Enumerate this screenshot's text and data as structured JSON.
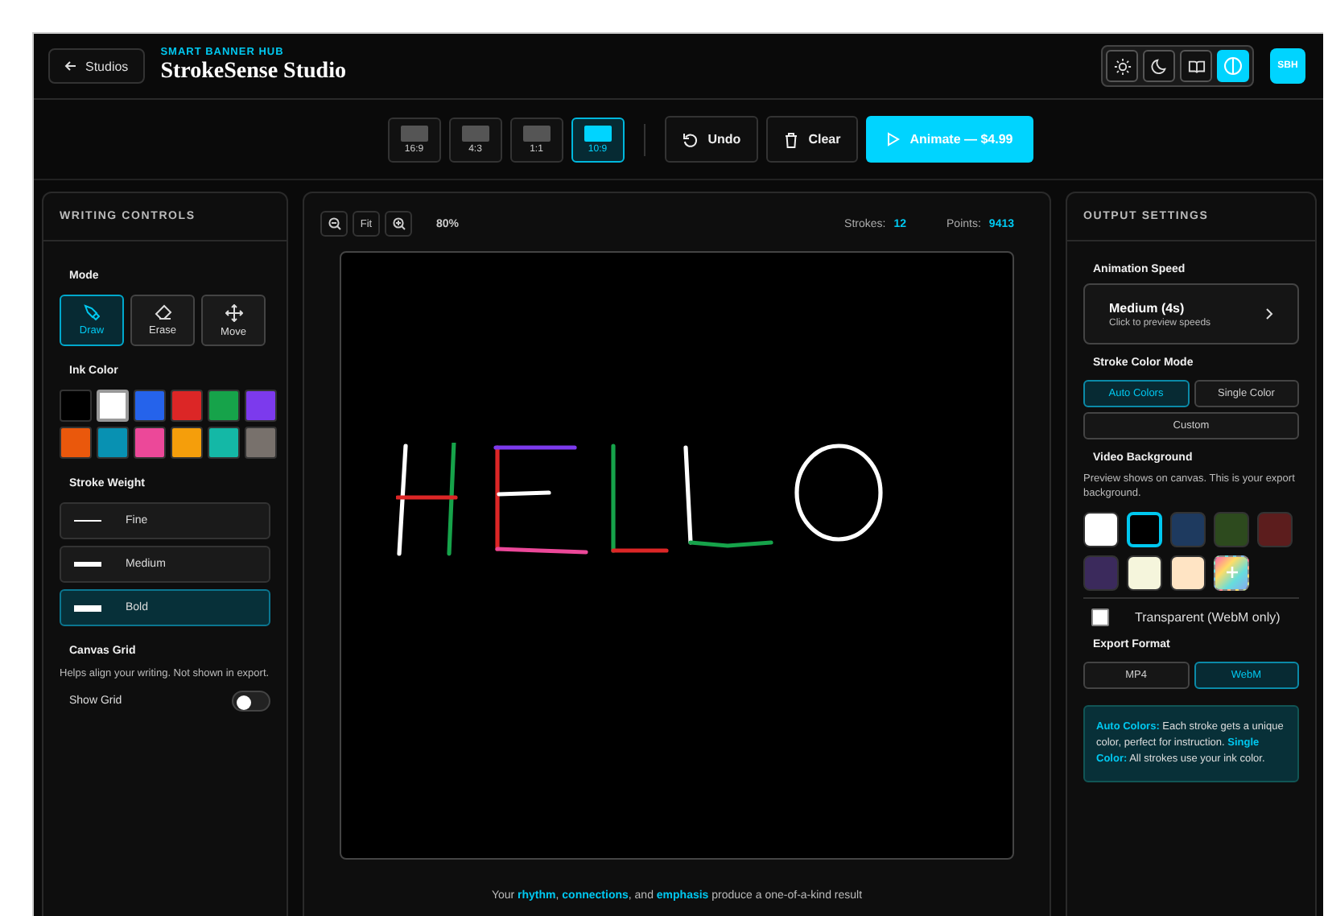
{
  "header": {
    "back_button": "Studios",
    "eyebrow": "SMART BANNER HUB",
    "title": "StrokeSense Studio",
    "theme_buttons": [
      {
        "kind": "sun",
        "selected": false
      },
      {
        "kind": "moon",
        "selected": false
      },
      {
        "kind": "book",
        "selected": false
      },
      {
        "kind": "contrast",
        "selected": true
      }
    ],
    "avatar": "SBH"
  },
  "toolbar": {
    "ratios": [
      {
        "label": "16:9",
        "selected": false
      },
      {
        "label": "4:3",
        "selected": false
      },
      {
        "label": "1:1",
        "selected": false
      },
      {
        "label": "10:9",
        "selected": true
      }
    ],
    "undo": "Undo",
    "clear": "Clear",
    "animate": "Animate — $4.99"
  },
  "writing_controls": {
    "title": "WRITING CONTROLS",
    "mode_label": "Mode",
    "modes": [
      {
        "kind": "draw",
        "label": "Draw",
        "selected": true
      },
      {
        "kind": "erase",
        "label": "Erase",
        "selected": false
      },
      {
        "kind": "move",
        "label": "Move",
        "selected": false
      }
    ],
    "ink_label": "Ink Color",
    "ink_colors": [
      {
        "color": "#000000",
        "selected": false
      },
      {
        "color": "#ffffff",
        "selected": true
      },
      {
        "color": "#2563eb",
        "selected": false
      },
      {
        "color": "#dc2626",
        "selected": false
      },
      {
        "color": "#16a34a",
        "selected": false
      },
      {
        "color": "#7c3aed",
        "selected": false
      },
      {
        "color": "#ea580c",
        "selected": false
      },
      {
        "color": "#0891b2",
        "selected": false
      },
      {
        "color": "#ec4899",
        "selected": false
      },
      {
        "color": "#f59e0b",
        "selected": false
      },
      {
        "color": "#14b8a6",
        "selected": false
      },
      {
        "color": "#78716c",
        "selected": false
      }
    ],
    "weight_label": "Stroke Weight",
    "weights": [
      {
        "kind": "fine",
        "label": "Fine",
        "selected": false
      },
      {
        "kind": "medium",
        "label": "Medium",
        "selected": false
      },
      {
        "kind": "bold",
        "label": "Bold",
        "selected": true
      }
    ],
    "grid_label": "Canvas Grid",
    "grid_hint": "Helps align your writing. Not shown in export.",
    "grid_toggle": {
      "label": "Show Grid",
      "on": false
    }
  },
  "canvas": {
    "fit": "Fit",
    "zoom": "80%",
    "strokes_label": "Strokes:",
    "strokes": "12",
    "points_label": "Points:",
    "points": "9413",
    "footer": "Your **rhythm**, **connections**, and **emphasis** produce a one-of-a-kind result"
  },
  "output_settings": {
    "title": "OUTPUT SETTINGS",
    "speed_label": "Animation Speed",
    "speed": "Medium (4s)",
    "speed_hint": "Click to preview speeds",
    "color_mode_label": "Stroke Color Mode",
    "color_modes": [
      {
        "label": "Auto Colors",
        "selected": true
      },
      {
        "label": "Single Color",
        "selected": false
      },
      {
        "label": "Custom",
        "selected": false
      }
    ],
    "background_label": "Video Background",
    "background_hint": "Preview shows on canvas. This is your export background.",
    "backgrounds": [
      {
        "kind": "solid",
        "color": "#ffffff",
        "selected": false
      },
      {
        "kind": "solid",
        "color": "#000000",
        "selected": true
      },
      {
        "kind": "solid",
        "color": "#1e3a5f",
        "selected": false
      },
      {
        "kind": "solid",
        "color": "#2d4a1e",
        "selected": false
      },
      {
        "kind": "solid",
        "color": "#5c1d1d",
        "selected": false
      },
      {
        "kind": "solid",
        "color": "#3b2a5c",
        "selected": false
      },
      {
        "kind": "solid",
        "color": "#f5f5dc",
        "selected": false
      },
      {
        "kind": "solid",
        "color": "#ffe4c4",
        "selected": false
      },
      {
        "kind": "custom",
        "selected": false
      }
    ],
    "transparent": {
      "label": "Transparent (WebM only)",
      "checked": false
    },
    "format_label": "Export Format",
    "formats": [
      {
        "label": "MP4",
        "selected": false
      },
      {
        "label": "WebM",
        "selected": true
      }
    ],
    "info": "**Auto Colors:** Each stroke gets a unique color, perfect for instruction. **Single Color:** All strokes use your ink color."
  }
}
